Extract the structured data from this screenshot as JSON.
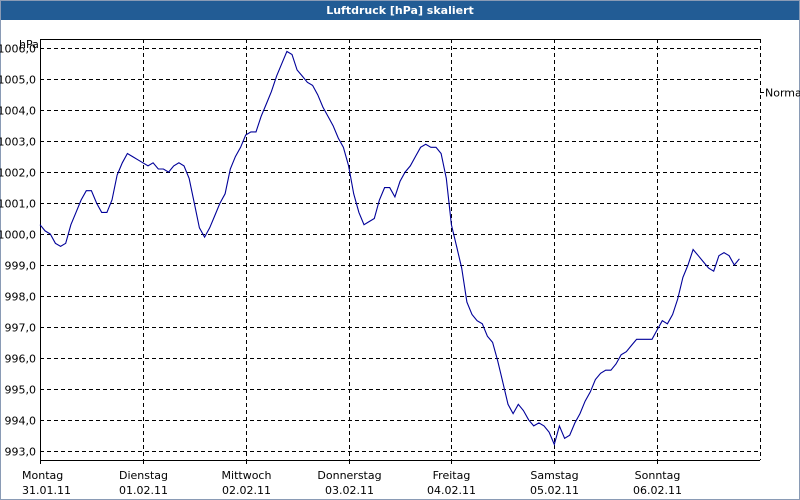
{
  "title": "Luftdruck [hPa] skaliert",
  "chart_data": {
    "type": "line",
    "title": "Luftdruck [hPa] skaliert",
    "ylabel": "hPa",
    "ylim": [
      992.7,
      1006.3
    ],
    "yticks": [
      {
        "v": 1006,
        "label": "1006,0"
      },
      {
        "v": 1005,
        "label": "1005,0"
      },
      {
        "v": 1004,
        "label": "1004,0"
      },
      {
        "v": 1003,
        "label": "1003,0"
      },
      {
        "v": 1002,
        "label": "1002,0"
      },
      {
        "v": 1001,
        "label": "1001,0"
      },
      {
        "v": 1000,
        "label": "1000,0"
      },
      {
        "v": 999,
        "label": "999,0"
      },
      {
        "v": 998,
        "label": "998,0"
      },
      {
        "v": 997,
        "label": "997,0"
      },
      {
        "v": 996,
        "label": "996,0"
      },
      {
        "v": 995,
        "label": "995,0"
      },
      {
        "v": 994,
        "label": "994,0"
      },
      {
        "v": 993,
        "label": "993,0"
      }
    ],
    "xlim": [
      0,
      7
    ],
    "xticks": [
      {
        "day": "Montag",
        "date": "31.01.11"
      },
      {
        "day": "Dienstag",
        "date": "01.02.11"
      },
      {
        "day": "Mittwoch",
        "date": "02.02.11"
      },
      {
        "day": "Donnerstag",
        "date": "03.02.11"
      },
      {
        "day": "Freitag",
        "date": "04.02.11"
      },
      {
        "day": "Samstag",
        "date": "05.02.11"
      },
      {
        "day": "Sonntag",
        "date": "06.02.11"
      }
    ],
    "marker_label": "Normal",
    "marker_value": 1004.6,
    "grid": true,
    "line_color": "#000099",
    "series": [
      {
        "values": [
          [
            0.0,
            1000.3
          ],
          [
            0.05,
            1000.1
          ],
          [
            0.1,
            1000.0
          ],
          [
            0.15,
            999.7
          ],
          [
            0.2,
            999.6
          ],
          [
            0.25,
            999.7
          ],
          [
            0.3,
            1000.3
          ],
          [
            0.35,
            1000.7
          ],
          [
            0.4,
            1001.1
          ],
          [
            0.45,
            1001.4
          ],
          [
            0.5,
            1001.4
          ],
          [
            0.55,
            1001.0
          ],
          [
            0.6,
            1000.7
          ],
          [
            0.65,
            1000.7
          ],
          [
            0.7,
            1001.1
          ],
          [
            0.75,
            1001.9
          ],
          [
            0.8,
            1002.3
          ],
          [
            0.85,
            1002.6
          ],
          [
            0.9,
            1002.5
          ],
          [
            0.95,
            1002.4
          ],
          [
            1.0,
            1002.3
          ],
          [
            1.05,
            1002.2
          ],
          [
            1.1,
            1002.3
          ],
          [
            1.15,
            1002.1
          ],
          [
            1.2,
            1002.1
          ],
          [
            1.25,
            1002.0
          ],
          [
            1.3,
            1002.2
          ],
          [
            1.35,
            1002.3
          ],
          [
            1.4,
            1002.2
          ],
          [
            1.45,
            1001.8
          ],
          [
            1.5,
            1001.0
          ],
          [
            1.55,
            1000.2
          ],
          [
            1.6,
            999.9
          ],
          [
            1.65,
            1000.2
          ],
          [
            1.7,
            1000.6
          ],
          [
            1.75,
            1001.0
          ],
          [
            1.8,
            1001.3
          ],
          [
            1.85,
            1002.1
          ],
          [
            1.9,
            1002.5
          ],
          [
            1.95,
            1002.8
          ],
          [
            2.0,
            1003.2
          ],
          [
            2.05,
            1003.3
          ],
          [
            2.1,
            1003.3
          ],
          [
            2.15,
            1003.8
          ],
          [
            2.2,
            1004.2
          ],
          [
            2.25,
            1004.6
          ],
          [
            2.3,
            1005.1
          ],
          [
            2.35,
            1005.5
          ],
          [
            2.4,
            1005.9
          ],
          [
            2.45,
            1005.8
          ],
          [
            2.5,
            1005.3
          ],
          [
            2.55,
            1005.1
          ],
          [
            2.6,
            1004.9
          ],
          [
            2.65,
            1004.8
          ],
          [
            2.7,
            1004.5
          ],
          [
            2.75,
            1004.1
          ],
          [
            2.8,
            1003.8
          ],
          [
            2.85,
            1003.5
          ],
          [
            2.9,
            1003.1
          ],
          [
            2.95,
            1002.8
          ],
          [
            3.0,
            1002.2
          ],
          [
            3.05,
            1001.3
          ],
          [
            3.1,
            1000.7
          ],
          [
            3.15,
            1000.3
          ],
          [
            3.2,
            1000.4
          ],
          [
            3.25,
            1000.5
          ],
          [
            3.3,
            1001.1
          ],
          [
            3.35,
            1001.5
          ],
          [
            3.4,
            1001.5
          ],
          [
            3.45,
            1001.2
          ],
          [
            3.5,
            1001.7
          ],
          [
            3.55,
            1002.0
          ],
          [
            3.6,
            1002.2
          ],
          [
            3.65,
            1002.5
          ],
          [
            3.7,
            1002.8
          ],
          [
            3.75,
            1002.9
          ],
          [
            3.8,
            1002.8
          ],
          [
            3.85,
            1002.8
          ],
          [
            3.9,
            1002.6
          ],
          [
            3.95,
            1001.8
          ],
          [
            4.0,
            1000.3
          ],
          [
            4.05,
            999.6
          ],
          [
            4.1,
            998.9
          ],
          [
            4.15,
            997.8
          ],
          [
            4.2,
            997.4
          ],
          [
            4.25,
            997.2
          ],
          [
            4.3,
            997.1
          ],
          [
            4.35,
            996.7
          ],
          [
            4.4,
            996.5
          ],
          [
            4.45,
            995.9
          ],
          [
            4.5,
            995.2
          ],
          [
            4.55,
            994.5
          ],
          [
            4.6,
            994.2
          ],
          [
            4.65,
            994.5
          ],
          [
            4.7,
            994.3
          ],
          [
            4.75,
            994.0
          ],
          [
            4.8,
            993.8
          ],
          [
            4.85,
            993.9
          ],
          [
            4.9,
            993.8
          ],
          [
            4.95,
            993.6
          ],
          [
            5.0,
            993.2
          ],
          [
            5.05,
            993.8
          ],
          [
            5.1,
            993.4
          ],
          [
            5.15,
            993.5
          ],
          [
            5.2,
            993.9
          ],
          [
            5.25,
            994.2
          ],
          [
            5.3,
            994.6
          ],
          [
            5.35,
            994.9
          ],
          [
            5.4,
            995.3
          ],
          [
            5.45,
            995.5
          ],
          [
            5.5,
            995.6
          ],
          [
            5.55,
            995.6
          ],
          [
            5.6,
            995.8
          ],
          [
            5.65,
            996.1
          ],
          [
            5.7,
            996.2
          ],
          [
            5.75,
            996.4
          ],
          [
            5.8,
            996.6
          ],
          [
            5.85,
            996.6
          ],
          [
            5.9,
            996.6
          ],
          [
            5.95,
            996.6
          ],
          [
            6.0,
            996.9
          ],
          [
            6.05,
            997.2
          ],
          [
            6.1,
            997.1
          ],
          [
            6.15,
            997.4
          ],
          [
            6.2,
            997.9
          ],
          [
            6.25,
            998.6
          ],
          [
            6.3,
            999.0
          ],
          [
            6.35,
            999.5
          ],
          [
            6.4,
            999.3
          ],
          [
            6.45,
            999.1
          ],
          [
            6.5,
            998.9
          ],
          [
            6.55,
            998.8
          ],
          [
            6.6,
            999.3
          ],
          [
            6.65,
            999.4
          ],
          [
            6.7,
            999.3
          ],
          [
            6.75,
            999.0
          ],
          [
            6.8,
            999.2
          ]
        ]
      }
    ]
  }
}
